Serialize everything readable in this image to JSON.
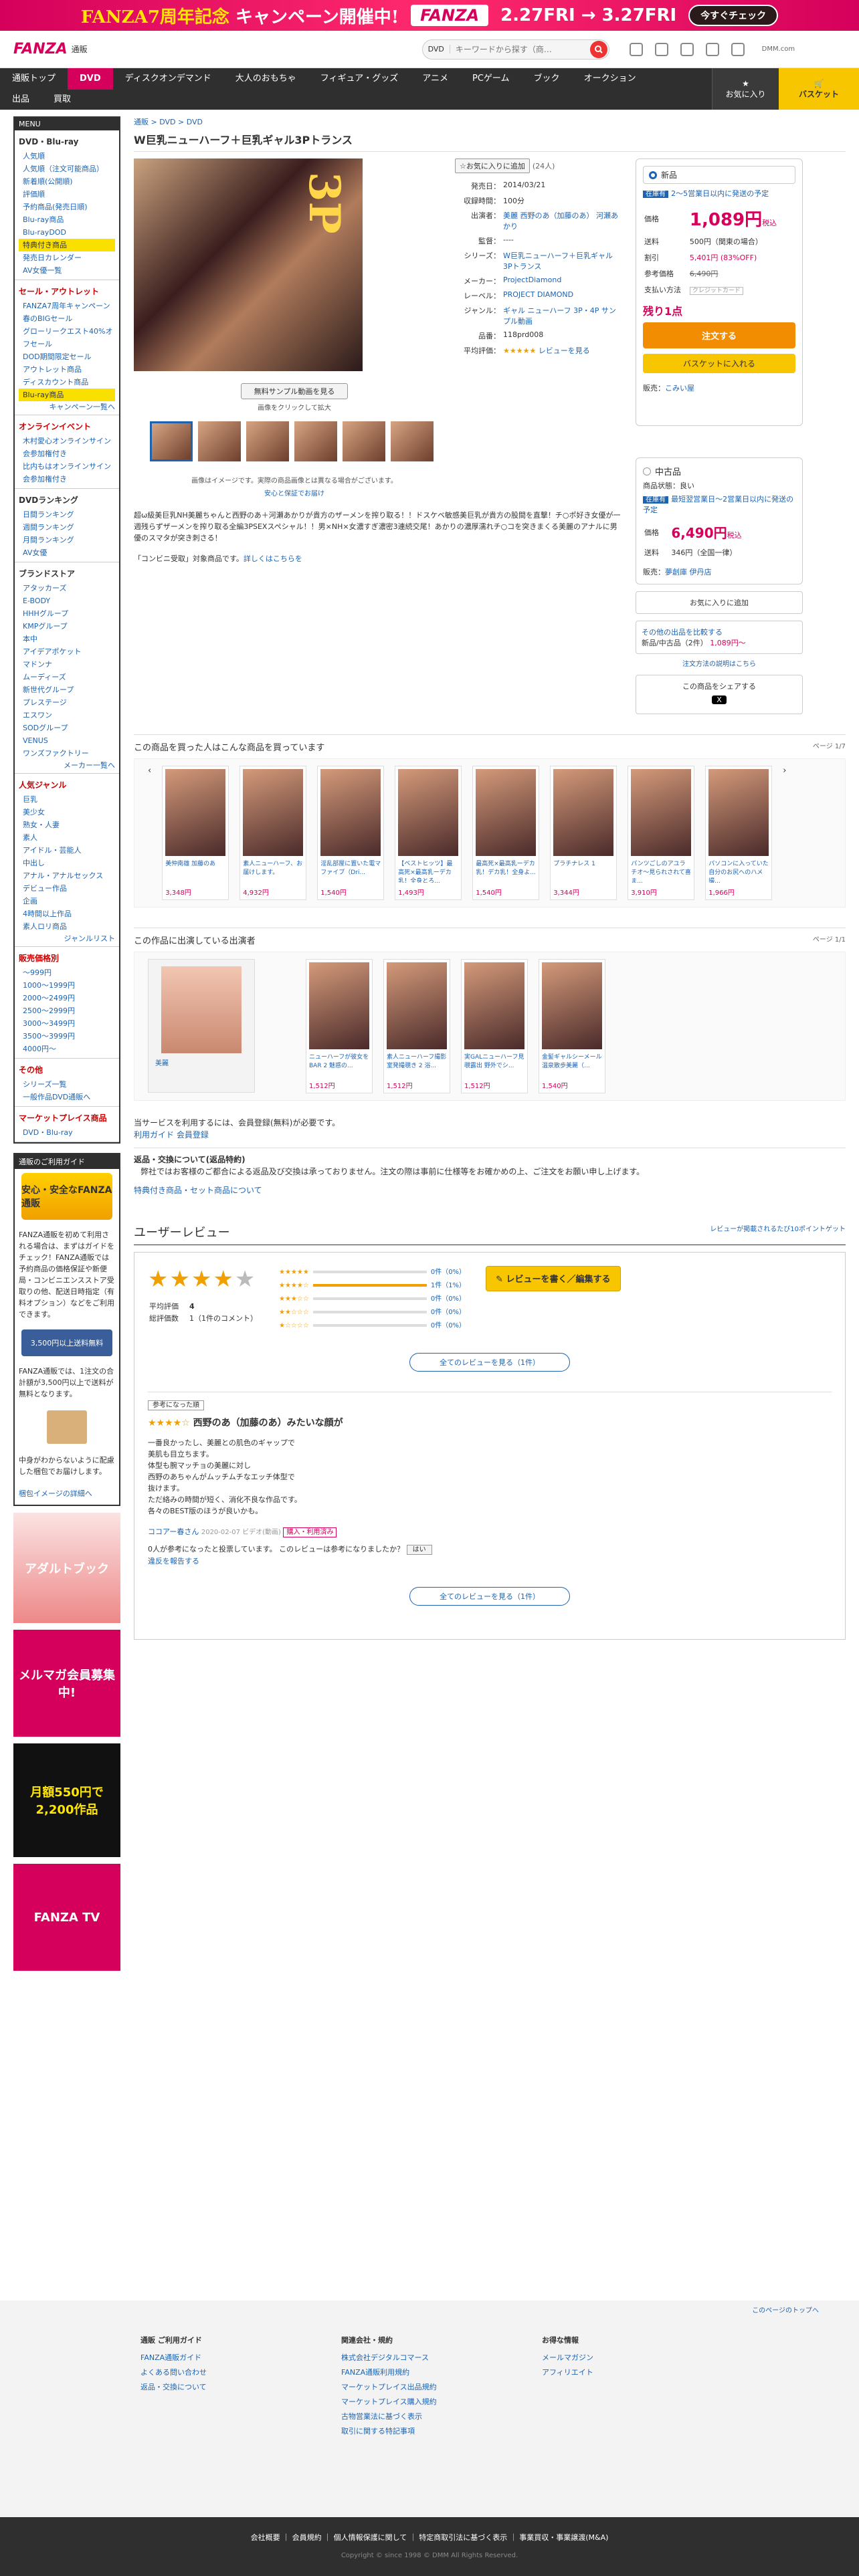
{
  "banner": {
    "title": "FANZA7周年記念",
    "campaign": "キャンペーン開催中!",
    "logo": "FANZA",
    "dates": "2.27FRI → 3.27FRI",
    "cta": "今すぐチェック"
  },
  "header": {
    "logo": "FANZA",
    "logo_sub": "通販",
    "search_scope": "DVD",
    "search_placeholder": "キーワードから探す（商…",
    "dmm": "DMM.com"
  },
  "nav": {
    "row1": [
      "通販トップ",
      "DVD",
      "ディスクオンデマンド",
      "大人のおもちゃ",
      "フィギュア・グッズ",
      "アニメ",
      "PCゲーム",
      "ブック",
      "オークション"
    ],
    "row2": [
      "出品",
      "買取"
    ],
    "fav": "お気に入り",
    "cart": "バスケット"
  },
  "sidebar": {
    "menu": "MENU",
    "groups": [
      {
        "title": "DVD・Blu-ray",
        "items": [
          "人気順",
          "人気順（注文可能商品）",
          "新着順(公開順)",
          "評価順",
          "予約商品(発売日順)",
          "Blu-ray商品",
          "Blu-rayDOD",
          "特典付き商品",
          "発売日カレンダー",
          "AV女優一覧"
        ]
      },
      {
        "title": "セール・アウトレット",
        "items": [
          "FANZA7周年キャンペーン",
          "春のBIGセール",
          "グローリークエスト40%オフセール",
          "DOD期間限定セール",
          "アウトレット商品",
          "ディスカウント商品",
          "Blu-ray商品"
        ],
        "more": "キャンペーン一覧へ"
      },
      {
        "title": "オンラインイベント",
        "items": [
          "木村愛心オンラインサイン会参加権付き",
          "比内もはオンラインサイン会参加権付き"
        ]
      },
      {
        "title": "DVDランキング",
        "items": [
          "日間ランキング",
          "週間ランキング",
          "月間ランキング",
          "AV女優"
        ]
      },
      {
        "title": "ブランドストア",
        "items": [
          "アタッカーズ",
          "E-BODY",
          "HHHグループ",
          "KMPグループ",
          "本中",
          "アイデアポケット",
          "マドンナ",
          "ムーディーズ",
          "新世代グループ",
          "プレステージ",
          "エスワン",
          "SODグループ",
          "VENUS",
          "ワンズファクトリー"
        ],
        "more": "メーカー一覧へ"
      },
      {
        "title": "人気ジャンル",
        "items": [
          "巨乳",
          "美少女",
          "熟女・人妻",
          "素人",
          "アイドル・芸能人",
          "中出し",
          "アナル・アナルセックス",
          "デビュー作品",
          "企画",
          "4時間以上作品",
          "素人ロリ商品"
        ],
        "more": "ジャンルリスト"
      },
      {
        "title": "販売価格別",
        "items": [
          "〜999円",
          "1000〜1999円",
          "2000〜2499円",
          "2500〜2999円",
          "3000〜3499円",
          "3500〜3999円",
          "4000円〜"
        ]
      },
      {
        "title": "その他",
        "items": [
          "シリーズ一覧",
          "一般作品DVD通販へ"
        ]
      },
      {
        "title": "マーケットプレイス商品",
        "items": [
          "DVD・Blu-ray"
        ]
      }
    ]
  },
  "guide": {
    "header": "通販のご利用ガイド",
    "badge": "安心・安全なFANZA通販",
    "text1": "FANZA通販を初めて利用される場合は、まずはガイドをチェック！FANZA通販では予約商品の価格保証や新便局・コンビニエンスストア受取りの他、配送日時指定（有料オプション）などをご利用できます。",
    "badge2": "3,500円以上送料無料",
    "text2": "FANZA通販では、1注文の合計額が3,500円以上で送料が無料となります。",
    "text3": "中身がわからないように配慮した梱包でお届けします。",
    "link": "梱包イメージの詳細へ",
    "ad1": "アダルトブック",
    "ad2": "メルマガ会員募集中!",
    "ad3": "月額550円で2,200作品",
    "ad4": "FANZA TV"
  },
  "crumb": "通販 > DVD > DVD",
  "product": {
    "title": "W巨乳ニューハーフ＋巨乳ギャル3Pトランス",
    "fav": "お気に入りに追加",
    "fav_count": "(24人)",
    "sample": "無料サンプル動画を見る",
    "click": "画像をクリックして拡大",
    "tnote": "画像はイメージです。実際の商品画像とは異なる場合がございます。",
    "tnote_link": "安心と保証でお届け",
    "info": [
      [
        "発売日：",
        "2014/03/21"
      ],
      [
        "収録時間：",
        "100分"
      ],
      [
        "出演者：",
        "美麗 西野のあ（加藤のあ） 河瀬あかり"
      ],
      [
        "監督：",
        "----"
      ],
      [
        "シリーズ：",
        "W巨乳ニューハーフ＋巨乳ギャル3Pトランス"
      ],
      [
        "メーカー：",
        "ProjectDiamond"
      ],
      [
        "レーベル：",
        "PROJECT DIAMOND"
      ],
      [
        "ジャンル：",
        "ギャル ニューハーフ 3P・4P サンプル動画"
      ],
      [
        "品番：",
        "118prd008"
      ],
      [
        "平均評価：",
        "レビューを見る"
      ]
    ],
    "desc": "超ω級美巨乳NH美麗ちゃんと西野のあ＋河瀬あかりが貴方のザーメンを搾り取る！！ドスケベ敏感美巨乳が貴方の股間を直撃！チ○ポ好き女優が一週残らずザーメンを搾り取る全編3PSEXスペシャル！！男×NH×女濃すぎ濃密3連続交尾！あかりの濃厚濡れチ○コを突きまくる美麗のアナルに男優のスマタが突き刺さる！",
    "convenience": "「コンビニ受取」対象商品です。",
    "more_link": "詳しくはこちらを"
  },
  "buy": {
    "new": "新品",
    "stock": "在庫有",
    "ship": "2〜5営業日以内に発送の予定",
    "price_label": "価格",
    "price": "1,089円",
    "tax": "税込",
    "shipping_label": "送料",
    "shipping": "500円（関東の場合）",
    "discount_label": "割引",
    "discount": "5,401円 (83%OFF)",
    "ref_label": "参考価格",
    "ref": "6,490円",
    "pay_label": "支払い方法",
    "pay": "クレジットカード",
    "left": "残り1点",
    "order": "注文する",
    "basket": "バスケットに入れる",
    "seller_label": "販売：",
    "seller": "こみい屋"
  },
  "used": {
    "title": "中古品",
    "cond": "商品状態：良い",
    "stock": "在庫有",
    "ship": "最短翌営業日〜2営業日以内に発送の予定",
    "price_label": "価格",
    "price": "6,490円",
    "tax": "税込",
    "ship_label": "送料",
    "shipping": "346円（全国一律）",
    "seller": "夢創庫 伊丹店"
  },
  "side": {
    "fav": "お気に入りに追加",
    "compare": "その他の出品を比較する",
    "compare_sub": "新品/中古品（2件）",
    "compare_price": "1,089円〜",
    "notice_link": "注文方法の説明はこちら",
    "share": "この商品をシェアする",
    "share_x": "X"
  },
  "also": {
    "title": "この商品を買った人はこんな商品を買っています",
    "page": "ページ 1/7",
    "items": [
      [
        "美仲南雄 加藤のあ",
        "3,348円"
      ],
      [
        "素人ニューハーフ、お届けします。",
        "4,932円"
      ],
      [
        "淫乱部屋に置いた電マファイブ（Dri...",
        "1,540円"
      ],
      [
        "【ベストヒッツ】最高死×最高乳ーデカ乳！全身とろ...",
        "1,493円"
      ],
      [
        "最高死×最高乳ーデカ乳！デカ乳！全身よ...",
        "1,540円"
      ],
      [
        "プラチナレス 1",
        "3,344円"
      ],
      [
        "パンツごしのアユラチオ〜見られされて喜ま...",
        "3,910円"
      ],
      [
        "パソコンに入っていた自分のお尻へのハメ撮...",
        "1,966円"
      ]
    ]
  },
  "cast": {
    "title": "この作品に出演している出演者",
    "page": "ページ 1/1",
    "actor": "美麗",
    "items": [
      [
        "ニューハーフが彼女をBAR 2 魅惑の...",
        "1,512円"
      ],
      [
        "素人ニューハーフ撮影室発撮覗き 2 浴...",
        "1,512円"
      ],
      [
        "実GALニューハーフ見覗露出 野外でシ...",
        "1,512円"
      ],
      [
        "金髪ギャルシーメール温泉散歩美麗（...",
        "1,540円"
      ]
    ]
  },
  "notice": {
    "line1": "当サービスを利用するには、会員登録(無料)が必要です。",
    "link1": "利用ガイド",
    "link2": "会員登録",
    "title": "返品・交換について(返品特約)",
    "text": "弊社ではお客様のご都合による返品及び交換は承っておりません。注文の際は事前に仕様等をお確かめの上、ご注文をお願い申し上げます。",
    "link3": "特典付き商品・セット商品について"
  },
  "review": {
    "title": "ユーザーレビュー",
    "points": "レビューが掲載されるたび10ポイントゲット",
    "write": "レビューを書く／編集する",
    "avg_label": "平均評価",
    "avg": "4",
    "total_label": "総評価数",
    "total": "1（1件のコメント）",
    "dist": [
      [
        "0件（0%）",
        false
      ],
      [
        "1件（1%）",
        true
      ],
      [
        "0件（0%）",
        false
      ],
      [
        "0件（0%）",
        false
      ],
      [
        "0件（0%）",
        false
      ]
    ],
    "all": "全てのレビューを見る（1件）",
    "sort": "参考になった順",
    "rtitle": "西野のあ（加藤のあ）みたいな顔が",
    "rbody": [
      "一番良かったし、美麗との肌色のギャップで",
      "美肌も目立ちます。",
      "体型も腕マッチョの美麗に対し",
      "西野のあちゃんがムッチムチなエッチ体型で",
      "抜けます。",
      "ただ絡みの時間が短く、消化不良な作品です。",
      "各々のBEST版のほうが良いかも。"
    ],
    "user": "ココアー春さん",
    "date": "2020-02-07 ビデオ(動画)",
    "badge": "購入・利用済み",
    "helpful": "0人が参考になったと投票しています。 このレビューは参考になりましたか？",
    "yes": "はい",
    "report": "違反を報告する"
  },
  "footer": {
    "top": "このページのトップへ",
    "cols": [
      {
        "h": "通販 ご利用ガイド",
        "l": [
          "FANZA通販ガイド",
          "よくある問い合わせ",
          "返品・交換について"
        ]
      },
      {
        "h": "関連会社・規約",
        "l": [
          "株式会社デジタルコマース",
          "FANZA通販利用規約",
          "マーケットプレイス出品規約",
          "マーケットプレイス購入規約",
          "古物営業法に基づく表示",
          "取引に関する特記事項"
        ]
      },
      {
        "h": "お得な情報",
        "l": [
          "メールマガジン",
          "アフィリエイト"
        ]
      }
    ],
    "bottom": "会社概要 ｜ 会員規約 ｜ 個人情報保護に関して ｜ 特定商取引法に基づく表示 ｜ 事業買収・事業譲渡(M&A)",
    "copy": "Copyright © since 1998 © DMM All Rights Reserved."
  }
}
